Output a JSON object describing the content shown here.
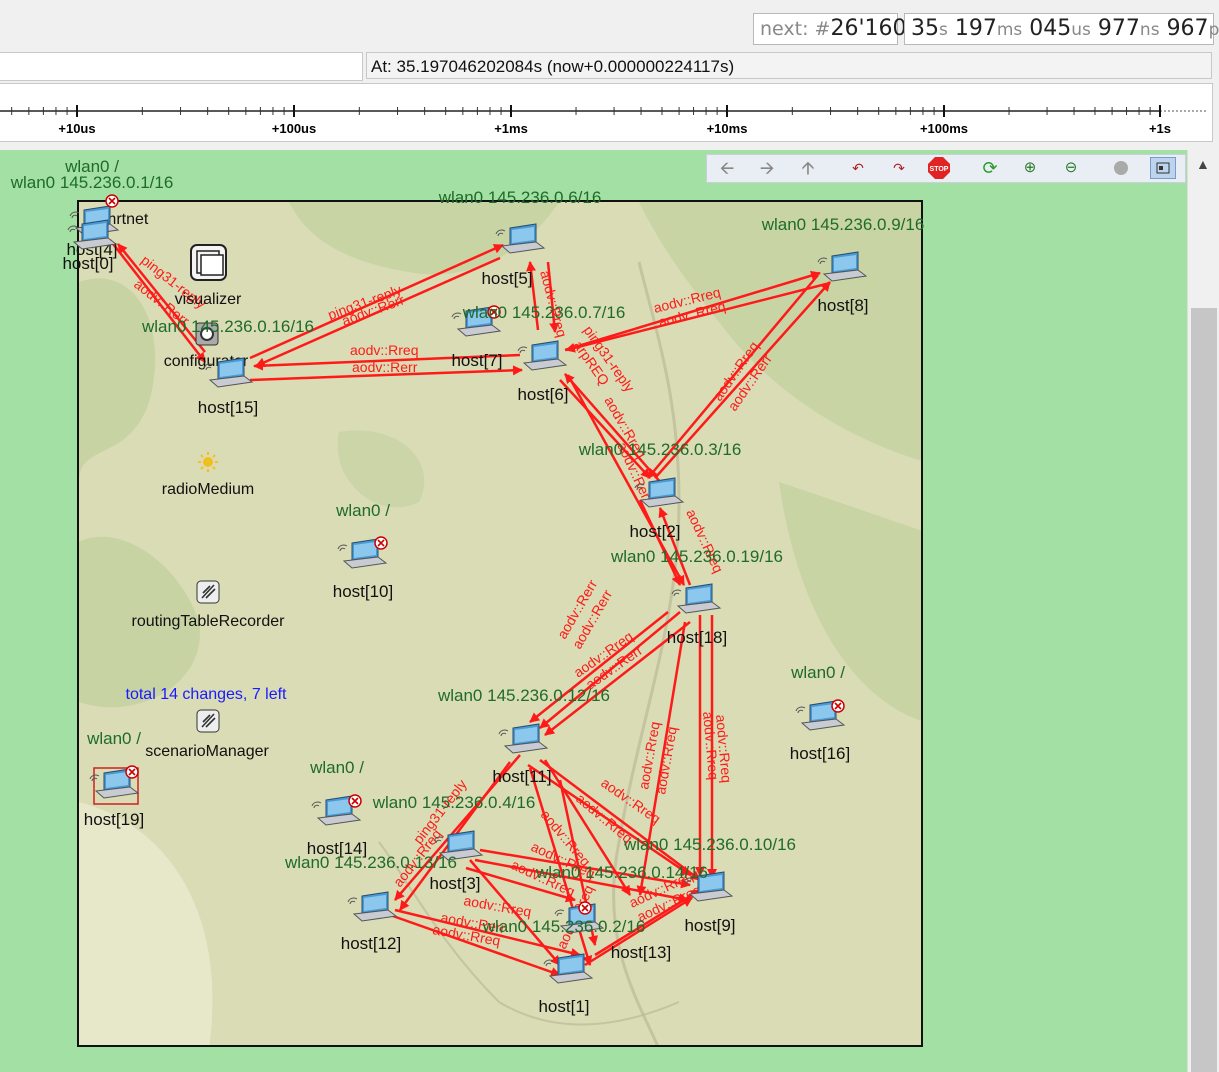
{
  "header": {
    "next_label": "next: #",
    "next_value": "26'160",
    "sim_time": [
      {
        "v": "35",
        "u": "s"
      },
      {
        "v": "197",
        "u": "ms"
      },
      {
        "v": "045",
        "u": "us"
      },
      {
        "v": "977",
        "u": "ns"
      },
      {
        "v": "967",
        "u": "ps"
      }
    ],
    "at_text": "At: 35.197046202084s (now+0.000000224117s)"
  },
  "timeline": {
    "ticks": [
      "+10us",
      "+100us",
      "+1ms",
      "+10ms",
      "+100ms",
      "+1s"
    ]
  },
  "toolbar": {
    "icons": [
      "back-icon",
      "forward-icon",
      "up-icon",
      "step-back-icon",
      "step-forward-icon",
      "stop-icon",
      "refresh-icon",
      "zoom-in-icon",
      "zoom-out-icon",
      "record-icon",
      "layout-icon"
    ],
    "stop_label": "STOP"
  },
  "network": {
    "modules": {
      "smartnet": "smrtnet",
      "visualizer": "visualizer",
      "configurator": "configurator",
      "radioMedium": "radioMedium",
      "routingTableRecorder": "routingTableRecorder",
      "scenarioManager": "scenarioManager",
      "changes": "total 14 changes, 7 left"
    },
    "hosts": [
      {
        "name": "host[4]",
        "addr": "wlan0 /"
      },
      {
        "name": "host[0]",
        "addr": "wlan0 145.236.0.1/16"
      },
      {
        "name": "host[15]",
        "addr": "wlan0 145.236.0.16/16"
      },
      {
        "name": "host[5]",
        "addr": "wlan0 145.236.0.6/16"
      },
      {
        "name": "host[7]",
        "addr": "wlan0 145.236.0.7/16"
      },
      {
        "name": "host[6]",
        "addr": ""
      },
      {
        "name": "host[8]",
        "addr": "wlan0 145.236.0.9/16"
      },
      {
        "name": "host[2]",
        "addr": "wlan0 145.236.0.3/16"
      },
      {
        "name": "host[18]",
        "addr": "wlan0 145.236.0.19/16"
      },
      {
        "name": "host[10]",
        "addr": "wlan0 /"
      },
      {
        "name": "host[11]",
        "addr": "wlan0 145.236.0.12/16"
      },
      {
        "name": "host[16]",
        "addr": "wlan0 /"
      },
      {
        "name": "host[19]",
        "addr": "wlan0 /"
      },
      {
        "name": "host[14]",
        "addr": "wlan0 /"
      },
      {
        "name": "host[3]",
        "addr": "wlan0 145.236.0.4/16"
      },
      {
        "name": "host[12]",
        "addr": "wlan0 145.236.0.13/16"
      },
      {
        "name": "host[9]",
        "addr": "wlan0 145.236.0.10/16"
      },
      {
        "name": "host[13]",
        "addr": "wlan0 145.236.0.14/16"
      },
      {
        "name": "host[1]",
        "addr": "wlan0 145.236.0.2/16"
      }
    ],
    "messages": [
      "ping31-reply",
      "aodv::Rerr",
      "aodv::Rreq",
      "arpREQ"
    ]
  },
  "colors": {
    "canvas_bg": "#a3e0a3",
    "map_bg": "#d9dcb4",
    "arrow": "#ff1a1a",
    "addr_text": "#1f6b2a",
    "changes_text": "#1a1aff"
  }
}
